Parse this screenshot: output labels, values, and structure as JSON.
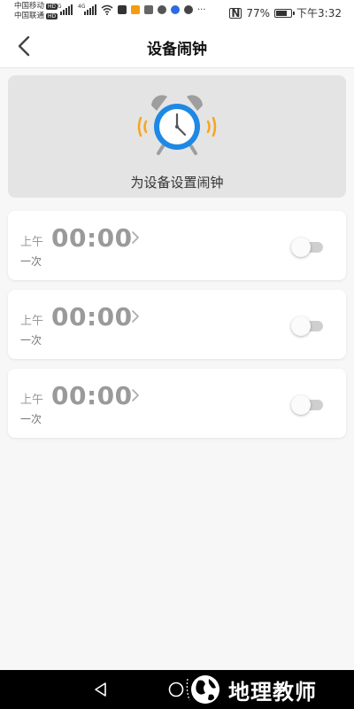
{
  "status_bar": {
    "carrier1": "中国移动",
    "carrier2": "中国联通",
    "hd_badge": "HD",
    "net1": "4G",
    "net2": "4G",
    "nfc": "N",
    "battery_percent": "77%",
    "battery_level": 0.77,
    "time": "下午3:32",
    "more": "···"
  },
  "header": {
    "title": "设备闹钟",
    "back_icon": "back-arrow-icon"
  },
  "banner": {
    "label": "为设备设置闹钟",
    "icon": "alarm-clock-icon",
    "colors": {
      "clock_ring": "#1e88e5",
      "clock_bells": "#9e9e9e",
      "vibration_lines": "#f5a623"
    }
  },
  "alarms": [
    {
      "ampm": "上午",
      "time": "00:00",
      "repeat": "一次",
      "enabled": false
    },
    {
      "ampm": "上午",
      "time": "00:00",
      "repeat": "一次",
      "enabled": false
    },
    {
      "ampm": "上午",
      "time": "00:00",
      "repeat": "一次",
      "enabled": false
    }
  ],
  "nav_bar": {
    "back_icon": "triangle-back-icon",
    "home_icon": "circle-home-icon",
    "watermark_text": "地理教师"
  }
}
